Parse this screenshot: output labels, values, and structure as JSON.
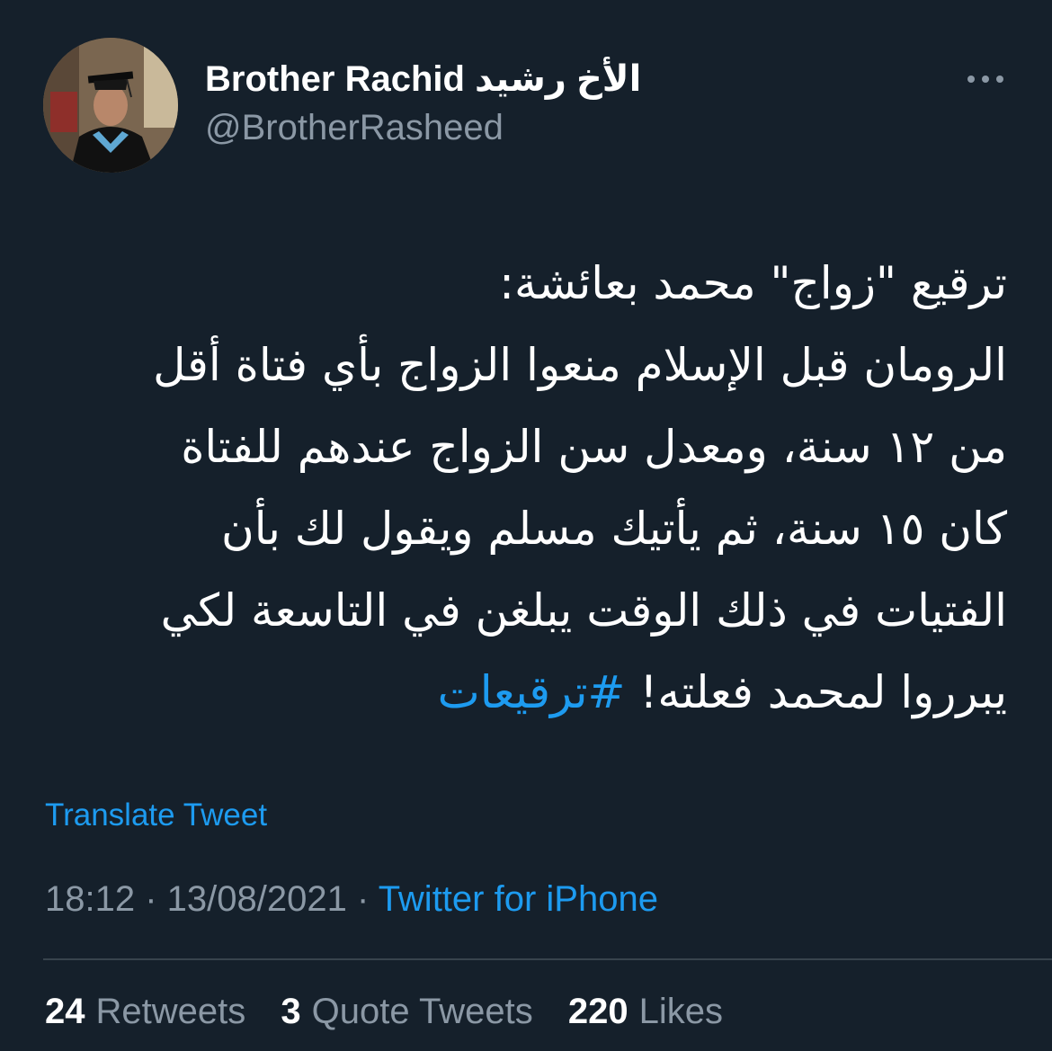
{
  "colors": {
    "background": "#15202b",
    "primary_text": "#ffffff",
    "secondary_text": "#8b98a5",
    "link": "#1d9bf0",
    "divider": "#38444d"
  },
  "author": {
    "display_name": "Brother Rachid الأخ رشيد",
    "handle": "@BrotherRasheed",
    "avatar_icon": "graduation-portrait-avatar"
  },
  "more_icon": "more-horizontal-icon",
  "tweet": {
    "lines": [
      "ترقيع \"زواج\" محمد بعائشة:",
      "الرومان قبل الإسلام منعوا الزواج بأي فتاة أقل",
      "من ١٢ سنة، ومعدل سن الزواج عندهم للفتاة",
      "كان ١٥ سنة، ثم يأتيك مسلم ويقول لك بأن",
      "الفتيات في ذلك الوقت يبلغن في التاسعة لكي"
    ],
    "last_line_text": "يبرروا لمحمد فعلته! ",
    "hashtag": "#ترقيعات"
  },
  "translate_label": "Translate Tweet",
  "meta": {
    "time": "18:12",
    "separator": " · ",
    "date": "13/08/2021",
    "source": "Twitter for iPhone"
  },
  "stats": {
    "retweets_count": "24",
    "retweets_label": "Retweets",
    "quotes_count": "3",
    "quotes_label": "Quote Tweets",
    "likes_count": "220",
    "likes_label": "Likes"
  }
}
